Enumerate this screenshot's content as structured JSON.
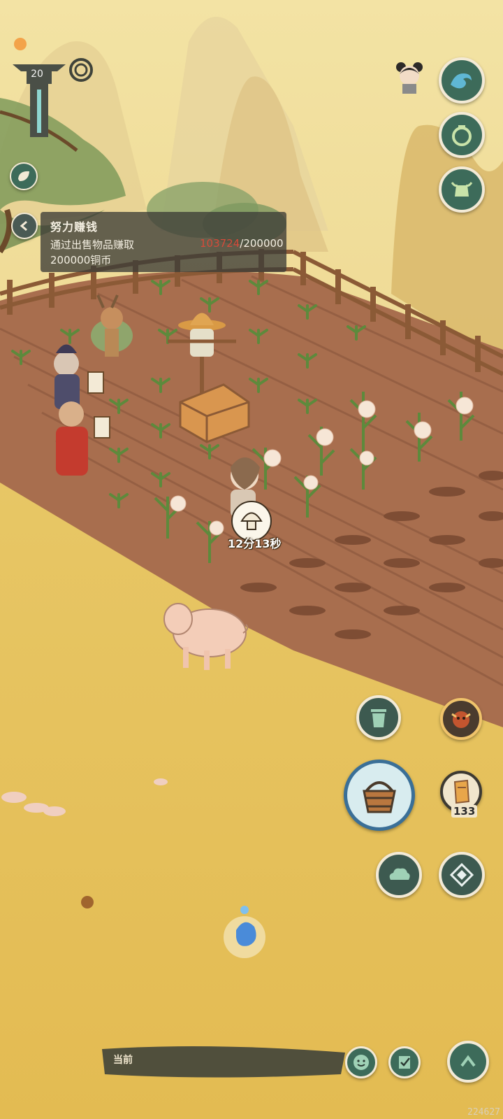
{
  "hud": {
    "level": "20",
    "uid": "224627"
  },
  "quest": {
    "title": "努力赚钱",
    "desc_line1": "通过出售物品赚取",
    "desc_line2": "200000铜币",
    "progress_current": "103724",
    "progress_target": "/200000"
  },
  "field": {
    "timer": "12分13秒"
  },
  "actions": {
    "bucket_count": "133"
  },
  "chat": {
    "channel_label": "当前"
  },
  "icons": {
    "top_right": [
      "wave-icon",
      "pouch-icon",
      "ox-icon"
    ],
    "right_tools": [
      "trash-icon",
      "monster-head-icon",
      "bucket-icon",
      "seed-bag-icon",
      "cloud-icon",
      "compass-icon"
    ],
    "bottom": [
      "smile-icon",
      "scroll-check-icon",
      "chevron-up-icon"
    ]
  },
  "colors": {
    "sky": "#efd98a",
    "grass": "#e6c25b",
    "soil": "#a2684a",
    "button": "#3d6b5a",
    "quest_progress": "#d64a3a"
  }
}
